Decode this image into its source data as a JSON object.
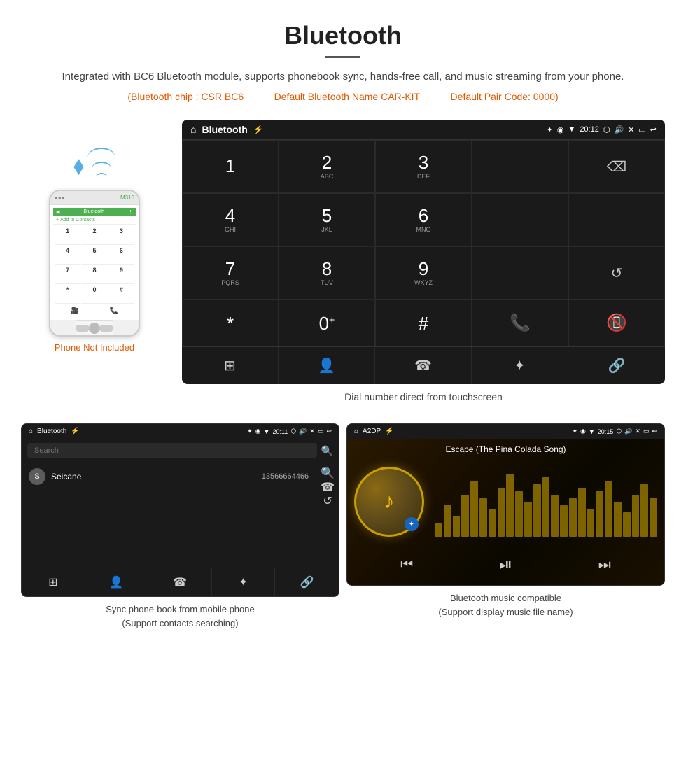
{
  "header": {
    "title": "Bluetooth",
    "description": "Integrated with BC6 Bluetooth module, supports phonebook sync, hands-free call, and music streaming from your phone.",
    "specs": {
      "chip": "(Bluetooth chip : CSR BC6",
      "name": "Default Bluetooth Name CAR-KIT",
      "pair_code": "Default Pair Code: 0000)"
    }
  },
  "phone_note": "Phone Not Included",
  "dial_screen": {
    "status_bar": {
      "title": "Bluetooth",
      "time": "20:12"
    },
    "keys": [
      {
        "main": "1",
        "sub": ""
      },
      {
        "main": "2",
        "sub": "ABC"
      },
      {
        "main": "3",
        "sub": "DEF"
      },
      {
        "main": "",
        "sub": ""
      },
      {
        "main": "⌫",
        "sub": ""
      },
      {
        "main": "4",
        "sub": "GHI"
      },
      {
        "main": "5",
        "sub": "JKL"
      },
      {
        "main": "6",
        "sub": "MNO"
      },
      {
        "main": "",
        "sub": ""
      },
      {
        "main": "",
        "sub": ""
      },
      {
        "main": "7",
        "sub": "PQRS"
      },
      {
        "main": "8",
        "sub": "TUV"
      },
      {
        "main": "9",
        "sub": "WXYZ"
      },
      {
        "main": "",
        "sub": ""
      },
      {
        "main": "↺",
        "sub": ""
      },
      {
        "main": "*",
        "sub": ""
      },
      {
        "main": "0",
        "sub": "+"
      },
      {
        "main": "#",
        "sub": ""
      },
      {
        "main": "📞",
        "sub": ""
      },
      {
        "main": "📵",
        "sub": ""
      }
    ],
    "bottom_nav": [
      "⊞",
      "👤",
      "☎",
      "✦",
      "🔗"
    ]
  },
  "dial_caption": "Dial number direct from touchscreen",
  "phonebook_screen": {
    "status_bar": {
      "title": "Bluetooth",
      "time": "20:11"
    },
    "search_placeholder": "Search",
    "contact": {
      "letter": "S",
      "name": "Seicane",
      "number": "13566664466"
    }
  },
  "phonebook_caption_line1": "Sync phone-book from mobile phone",
  "phonebook_caption_line2": "(Support contacts searching)",
  "music_screen": {
    "status_bar": {
      "title": "A2DP",
      "time": "20:15"
    },
    "song_title": "Escape (The Pina Colada Song)"
  },
  "music_caption_line1": "Bluetooth music compatible",
  "music_caption_line2": "(Support display music file name)",
  "waveform_heights": [
    20,
    45,
    30,
    60,
    80,
    55,
    40,
    70,
    90,
    65,
    50,
    75,
    85,
    60,
    45,
    55,
    70,
    40,
    65,
    80,
    50,
    35,
    60,
    75,
    55
  ],
  "icons": {
    "home": "⌂",
    "usb": "⚡",
    "bluetooth": "✦",
    "wifi": "▼",
    "location": "◉",
    "battery": "▐",
    "camera": "⬡",
    "volume": "🔊",
    "close_x": "✕",
    "window": "⬜",
    "back": "↩",
    "search": "🔍",
    "phone_green": "📞",
    "phone_red": "📵",
    "grid": "⊞",
    "user": "👤",
    "phone": "☎",
    "bt": "✦",
    "link": "🔗",
    "prev": "⏮",
    "play_pause": "⏯",
    "next": "⏭",
    "refresh": "↺",
    "backspace": "⌫"
  }
}
